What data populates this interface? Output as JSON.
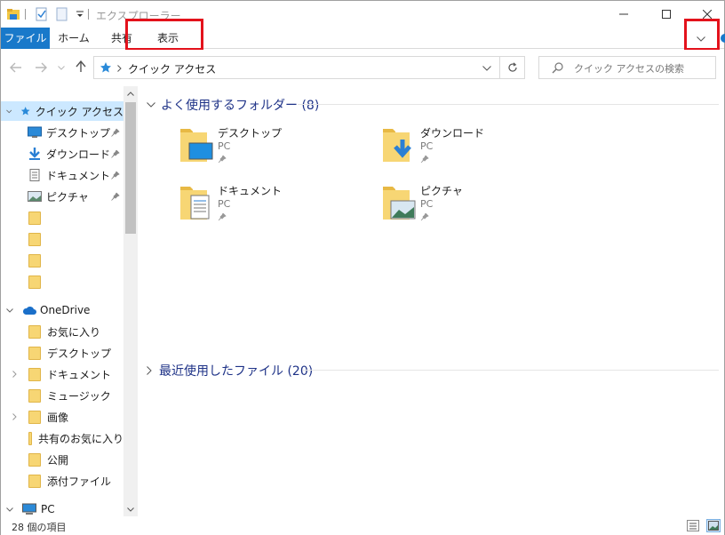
{
  "window": {
    "title": "エクスプローラー"
  },
  "ribbon": {
    "tabs": [
      "ファイル",
      "ホーム",
      "共有",
      "表示"
    ]
  },
  "address": {
    "path": "クイック アクセス",
    "search_placeholder": "クイック アクセスの検索"
  },
  "sidebar": {
    "quick_access": "クイック アクセス",
    "pinned": [
      "デスクトップ",
      "ダウンロード",
      "ドキュメント",
      "ピクチャ"
    ],
    "onedrive": "OneDrive",
    "onedrive_items": [
      "お気に入り",
      "デスクトップ",
      "ドキュメント",
      "ミュージック",
      "画像",
      "共有のお気に入り",
      "公開",
      "添付ファイル"
    ],
    "pc": "PC"
  },
  "content": {
    "frequent_header": "よく使用するフォルダー (8)",
    "recent_header": "最近使用したファイル (20)",
    "tiles": [
      {
        "name": "デスクトップ",
        "location": "PC"
      },
      {
        "name": "ダウンロード",
        "location": "PC"
      },
      {
        "name": "ドキュメント",
        "location": "PC"
      },
      {
        "name": "ピクチャ",
        "location": "PC"
      }
    ]
  },
  "status": {
    "item_count": "28 個の項目"
  },
  "colors": {
    "accent": "#1979ca",
    "highlight": "#e3121c",
    "selection": "#cce8ff",
    "folder": "#f7d674"
  }
}
